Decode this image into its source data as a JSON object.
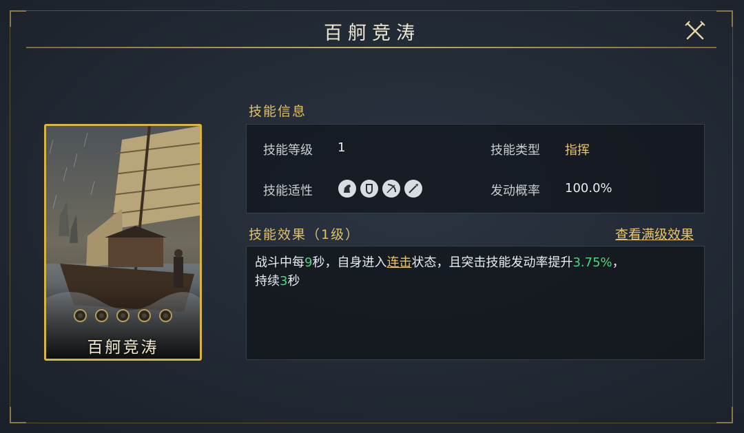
{
  "title": "百舸竞涛",
  "card": {
    "name": "百舸竞涛",
    "orb_count": 5
  },
  "info": {
    "section_title": "技能信息",
    "level_label": "技能等级",
    "level_value": "1",
    "type_label": "技能类型",
    "type_value": "指挥",
    "aptitude_label": "技能适性",
    "aptitude_icons": [
      "cavalry-icon",
      "shield-icon",
      "bow-icon",
      "spear-icon"
    ],
    "rate_label": "发动概率",
    "rate_value": "100.0%"
  },
  "effect": {
    "section_title": "技能效果（1级）",
    "view_max_label": "查看满级效果",
    "line1_a": "战斗中每",
    "line1_num1": "9",
    "line1_b": "秒，自身进入",
    "line1_link": "连击",
    "line1_c": "状态，且突击技能发动率提升",
    "line1_num2": "3.75%",
    "line1_d": "，",
    "line2_a": "持续",
    "line2_num": "3",
    "line2_b": "秒"
  },
  "colors": {
    "gold": "#e8c56a",
    "green": "#4fd47d",
    "card_border": "#d8b442"
  }
}
